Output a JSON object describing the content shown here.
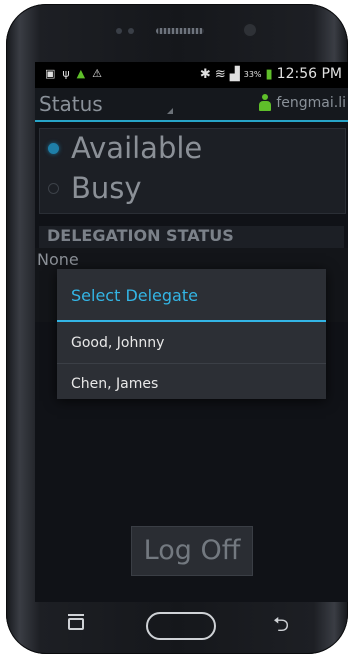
{
  "status_bar": {
    "battery_percent": "33%",
    "time": "12:56 PM"
  },
  "app": {
    "title": "Status",
    "username": "fengmai.li"
  },
  "status_options": [
    {
      "label": "Available",
      "selected": true
    },
    {
      "label": "Busy",
      "selected": false
    }
  ],
  "delegation": {
    "header": "DELEGATION STATUS",
    "value": "None"
  },
  "logoff_label": "Log Off",
  "dialog": {
    "title": "Select Delegate",
    "items": [
      "Good, Johnny",
      "Chen, James"
    ]
  },
  "colors": {
    "accent": "#33b5e5",
    "user_icon": "#5fbf2a"
  },
  "icons": [
    "message-icon",
    "usb-icon",
    "notification-icon",
    "warning-icon",
    "bluetooth-icon",
    "wifi-icon",
    "signal-icon",
    "battery-icon",
    "person-icon",
    "recent-apps-icon",
    "home-icon",
    "back-icon"
  ]
}
